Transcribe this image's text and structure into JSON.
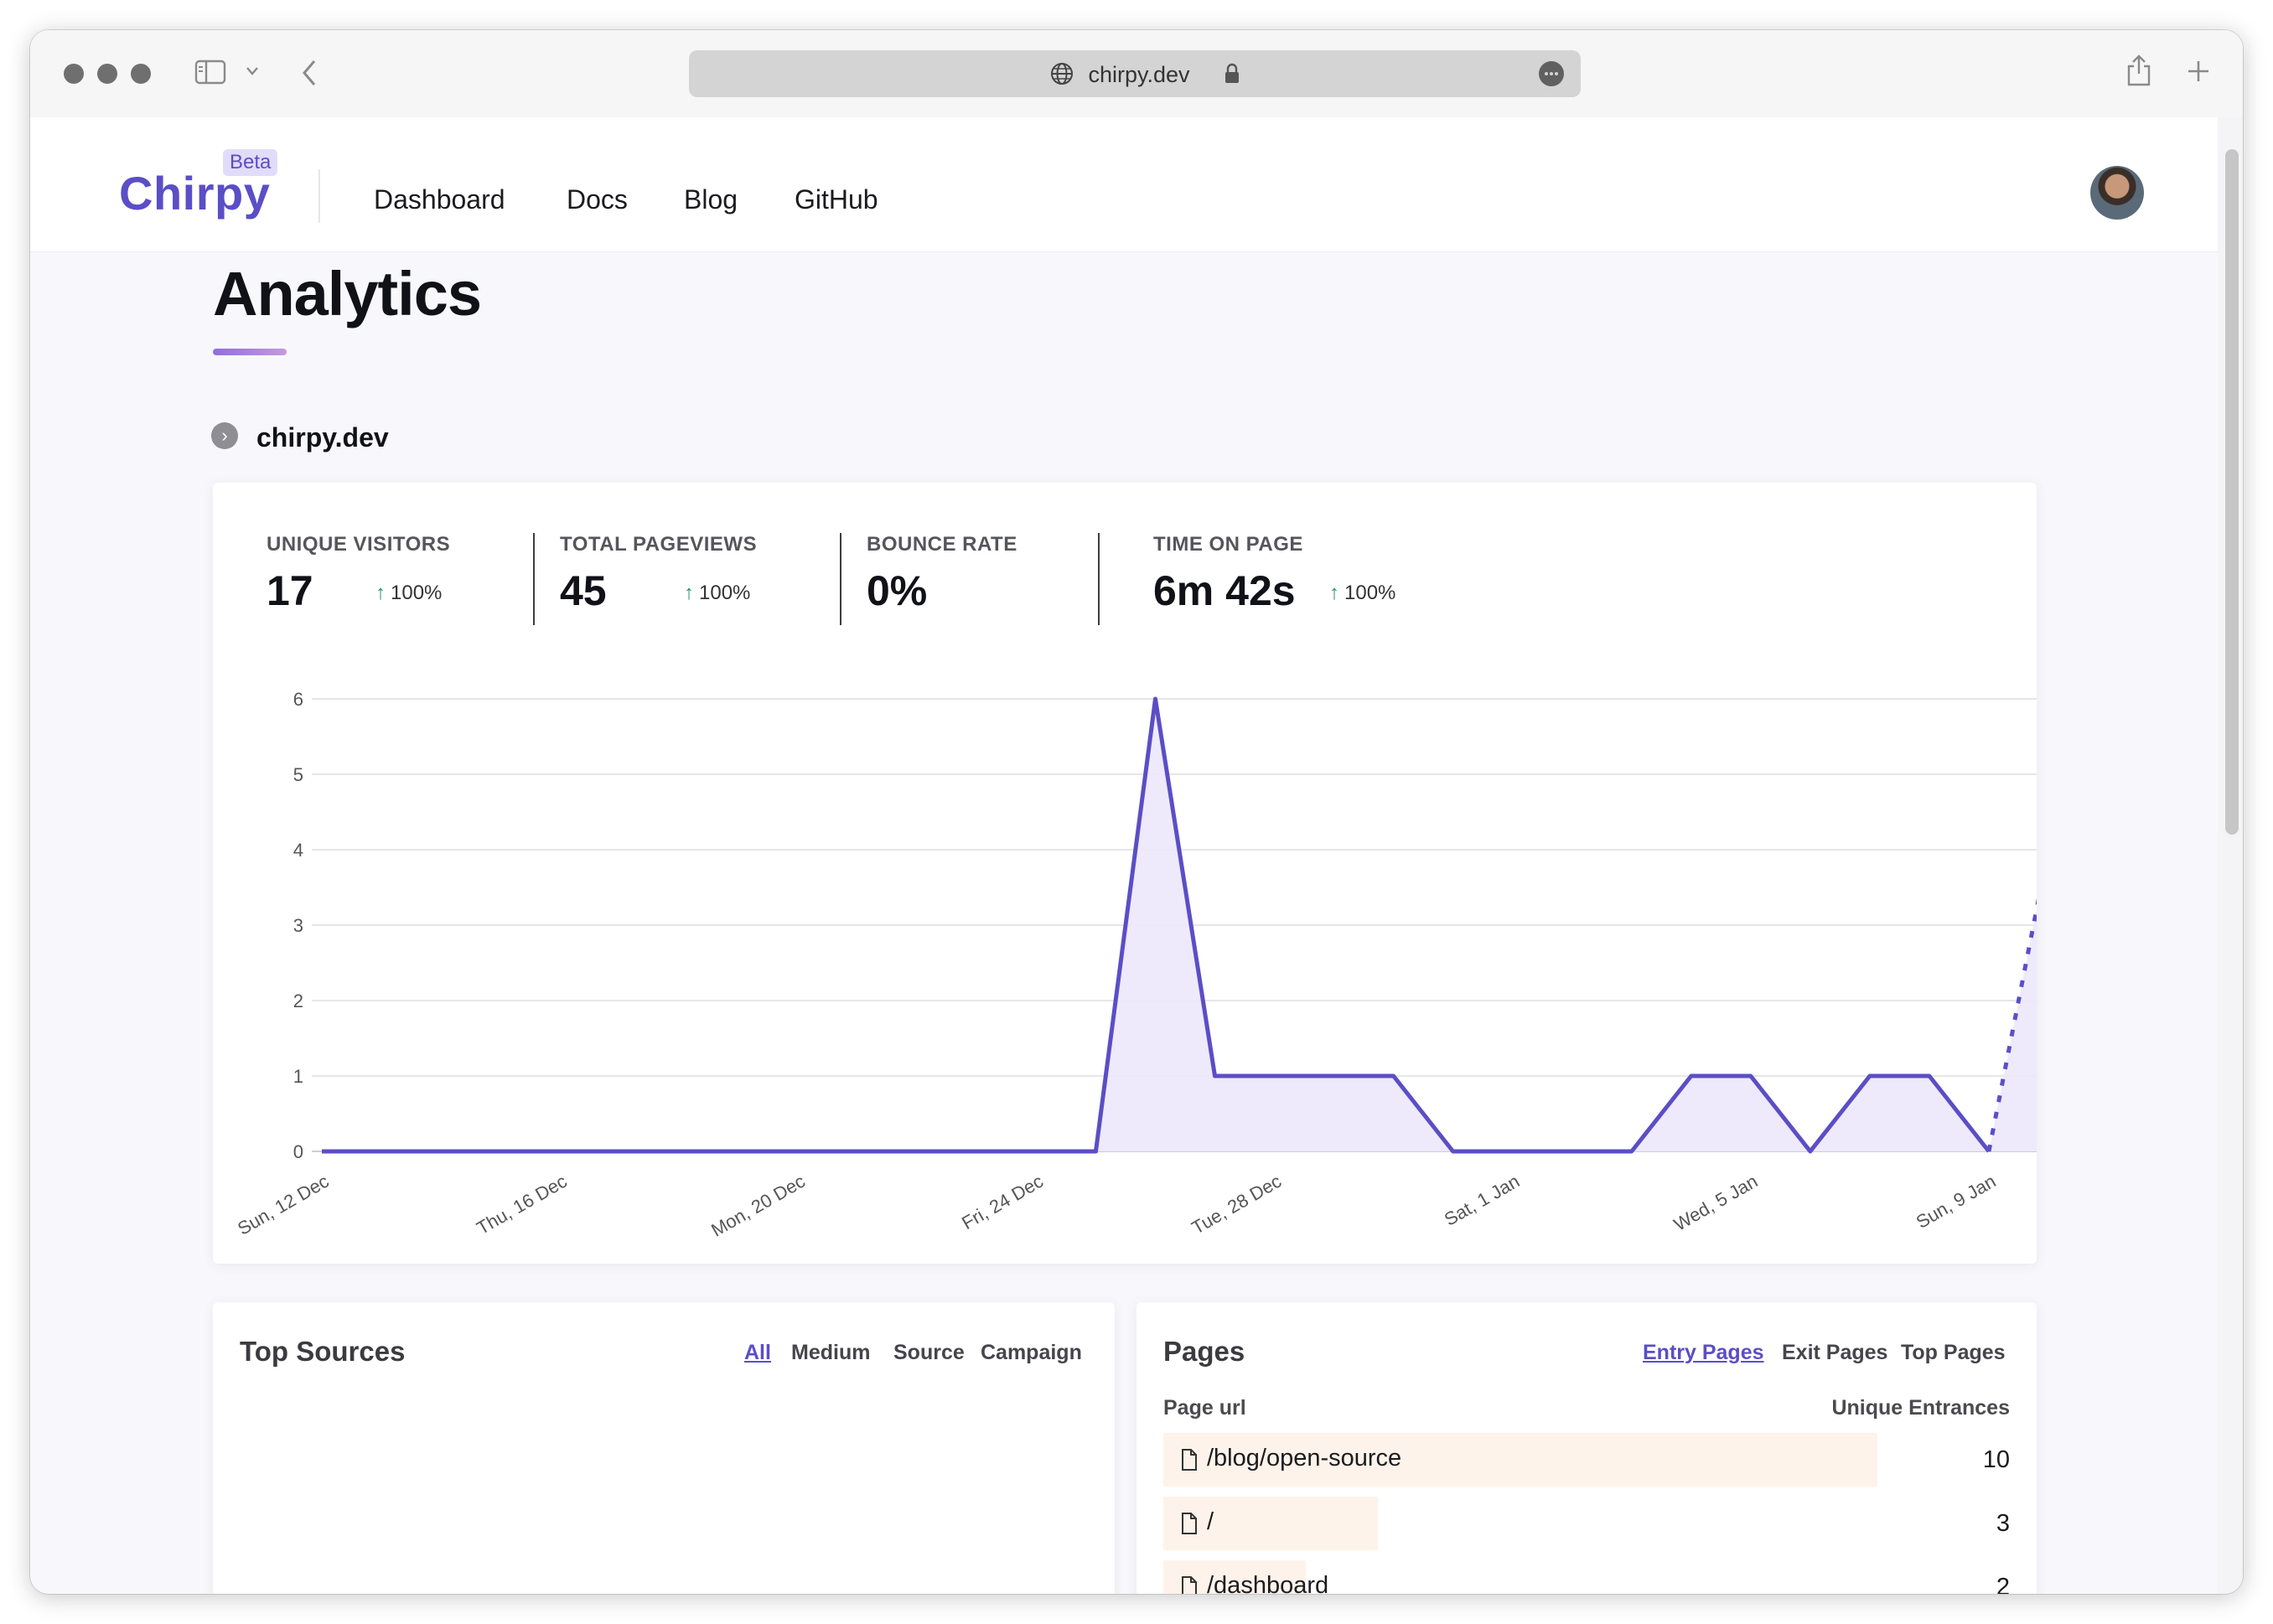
{
  "browser": {
    "url": "chirpy.dev"
  },
  "header": {
    "logo": "Chirpy",
    "badge": "Beta",
    "nav": [
      "Dashboard",
      "Docs",
      "Blog",
      "GitHub"
    ]
  },
  "page": {
    "title": "Analytics",
    "site": "chirpy.dev"
  },
  "stats": [
    {
      "label": "UNIQUE VISITORS",
      "value": "17",
      "change": "100%"
    },
    {
      "label": "TOTAL PAGEVIEWS",
      "value": "45",
      "change": "100%"
    },
    {
      "label": "BOUNCE RATE",
      "value": "0%",
      "change": ""
    },
    {
      "label": "TIME ON PAGE",
      "value": "6m 42s",
      "change": "100%"
    }
  ],
  "chart_data": {
    "type": "area",
    "x": [
      "12 Dec",
      "13 Dec",
      "14 Dec",
      "15 Dec",
      "16 Dec",
      "17 Dec",
      "18 Dec",
      "19 Dec",
      "20 Dec",
      "21 Dec",
      "22 Dec",
      "23 Dec",
      "24 Dec",
      "25 Dec",
      "26 Dec",
      "27 Dec",
      "28 Dec",
      "29 Dec",
      "30 Dec",
      "31 Dec",
      "1 Jan",
      "2 Jan",
      "3 Jan",
      "4 Jan",
      "5 Jan",
      "6 Jan",
      "7 Jan",
      "8 Jan",
      "9 Jan",
      "10 Jan",
      "11 Jan"
    ],
    "values": [
      0,
      0,
      0,
      0,
      0,
      0,
      0,
      0,
      0,
      0,
      0,
      0,
      0,
      0,
      6,
      1,
      1,
      1,
      1,
      0,
      0,
      0,
      0,
      1,
      1,
      0,
      1,
      1,
      0,
      4
    ],
    "dotted_last_segment": true,
    "xtick_labels": [
      "Sun, 12 Dec",
      "Thu, 16 Dec",
      "Mon, 20 Dec",
      "Fri, 24 Dec",
      "Tue, 28 Dec",
      "Sat, 1 Jan",
      "Wed, 5 Jan",
      "Sun, 9 Jan"
    ],
    "yticks": [
      0,
      1,
      2,
      3,
      4,
      5,
      6
    ],
    "ylim": [
      0,
      6
    ],
    "grid": true,
    "line_color": "#5b4ec6",
    "fill_color": "#ece8fb"
  },
  "top_sources": {
    "title": "Top Sources",
    "tabs": [
      "All",
      "Medium",
      "Source",
      "Campaign"
    ],
    "active_tab": "All"
  },
  "pages": {
    "title": "Pages",
    "tabs": [
      "Entry Pages",
      "Exit Pages",
      "Top Pages"
    ],
    "active_tab": "Entry Pages",
    "col_url": "Page url",
    "col_count": "Unique Entrances",
    "rows": [
      {
        "url": "/blog/open-source",
        "count": "10",
        "share": 1.0
      },
      {
        "url": "/",
        "count": "3",
        "share": 0.3
      },
      {
        "url": "/dashboard",
        "count": "2",
        "share": 0.2
      }
    ]
  }
}
